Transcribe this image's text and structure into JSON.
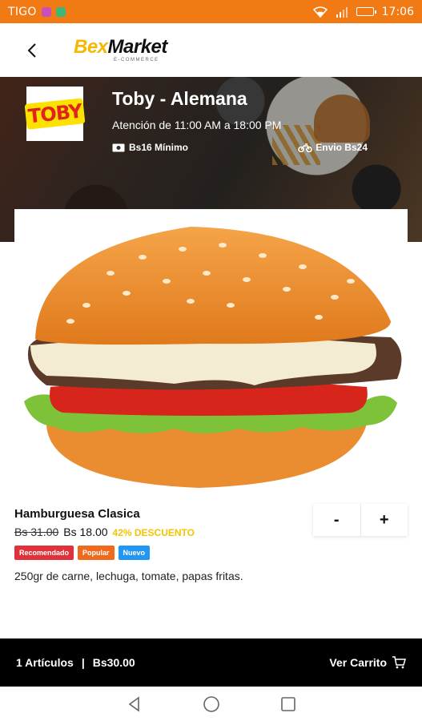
{
  "status_bar": {
    "carrier": "TIGO",
    "time": "17:06"
  },
  "app_bar": {
    "logo_bex": "Bex",
    "logo_market": "Market",
    "logo_sub": "E-COMMERCE"
  },
  "store": {
    "logo_text": "TOBY",
    "name": "Toby - Alemana",
    "hours": "Atención de 11:00 AM a 18:00 PM",
    "minimum": "Bs16 Mínimo",
    "shipping": "Envio Bs24"
  },
  "product": {
    "name": "Hamburguesa Clasica",
    "old_price": "Bs 31.00",
    "new_price": "Bs 18.00",
    "discount": "42% DESCUENTO",
    "badges": [
      "Recomendado",
      "Popular",
      "Nuevo"
    ],
    "description": "250gr de carne, lechuga, tomate, papas fritas.",
    "stepper_minus": "-",
    "stepper_plus": "+"
  },
  "cart": {
    "items": "1 Artículos",
    "separator": "|",
    "total": "Bs30.00",
    "view_label": "Ver Carrito"
  },
  "colors": {
    "status_bar": "#f27a14",
    "brand_yellow": "#f5b800",
    "discount": "#f5c400",
    "badge_red": "#e0323b",
    "badge_orange": "#ef6a1d",
    "badge_blue": "#2196f3"
  }
}
